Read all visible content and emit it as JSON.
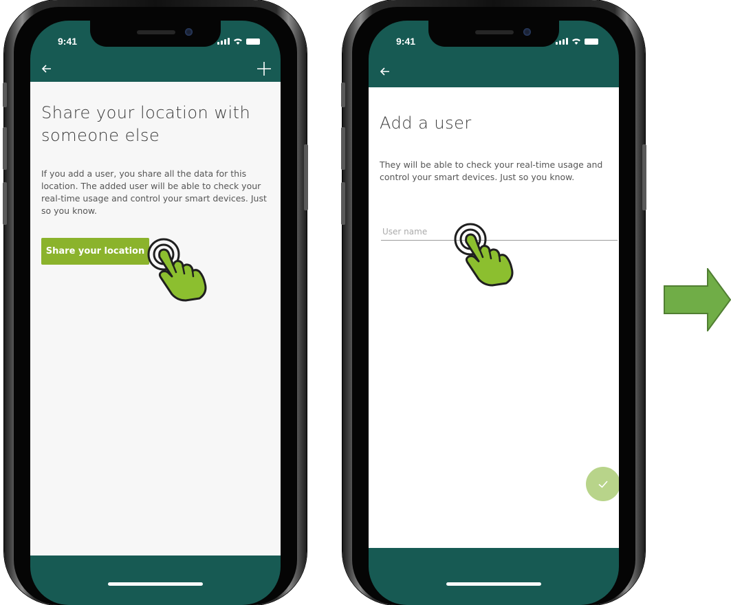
{
  "colors": {
    "app_bar": "#175a53",
    "accent_green": "#8bb32c",
    "fab_green": "#b8d48a",
    "arrow_green": "#70ad47",
    "hand_green": "#8cbf2f"
  },
  "screen1": {
    "status_time": "9:41",
    "back_icon": "arrow-left-icon",
    "add_icon": "plus-icon",
    "title": "Share your location with someone else",
    "body": "If you add a user, you share all the data for this location. The added user will be able to check your real-time usage and control your smart devices. Just so you know.",
    "share_button_label": "Share your location"
  },
  "screen2": {
    "status_time": "9:41",
    "back_icon": "arrow-left-icon",
    "title": "Add a user",
    "body": "They will be able to check your real-time usage and control your smart devices. Just so you know.",
    "user_name_placeholder": "User name",
    "user_name_value": "",
    "confirm_icon": "checkmark-icon"
  },
  "annotations": {
    "next_arrow_icon": "right-arrow-icon",
    "tap_hand_icon": "tap-hand-icon"
  }
}
